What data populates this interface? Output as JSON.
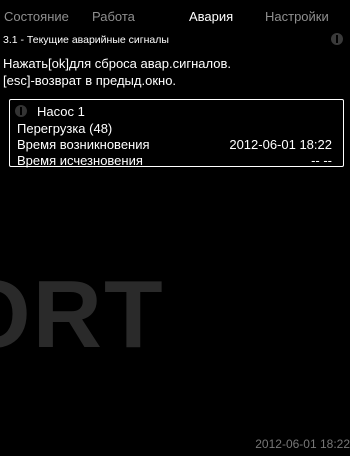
{
  "tabs": {
    "status": "Состояние",
    "operation": "Работа",
    "alarm": "Авария",
    "settings": "Настройки"
  },
  "screen": {
    "title": "3.1 - Текущие аварийные сигналы",
    "instruction_line1": "Нажать[ok]для сброса авар.сигналов.",
    "instruction_line2": "[esc]-возврат в предыд.окно."
  },
  "alarm": {
    "pump": "Насос 1",
    "description": "Перегрузка (48)",
    "occurred_label": "Время возникновения",
    "occurred_value": "2012-06-01 18:22",
    "cleared_label": "Время исчезновения",
    "cleared_value": "--     --"
  },
  "watermark": "ORT",
  "footer": {
    "clock": "2012-06-01 18:22"
  },
  "colors": {
    "background": "#000000",
    "active_text": "#ffffff",
    "inactive_tab": "#8f8f8f",
    "clock": "#777777"
  },
  "icons": [
    "alarm-icon"
  ]
}
